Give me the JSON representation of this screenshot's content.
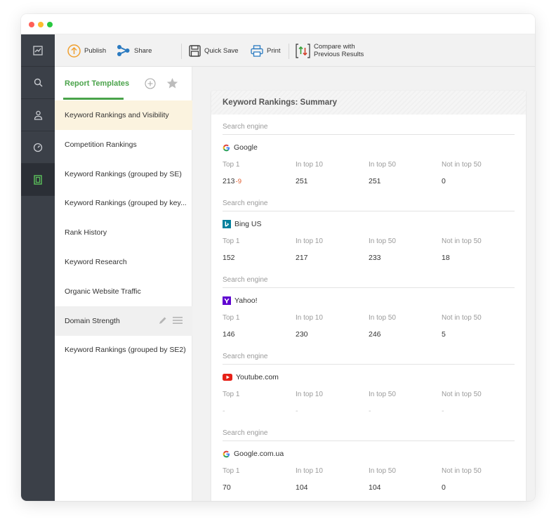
{
  "window": {
    "dots": [
      {
        "name": "close",
        "color": "#ff5f57"
      },
      {
        "name": "minimize",
        "color": "#febc2e"
      },
      {
        "name": "maximize",
        "color": "#28c840"
      }
    ]
  },
  "leftbar": {
    "items": [
      {
        "icon": "chart-icon",
        "active": false
      },
      {
        "icon": "search-icon",
        "active": false
      },
      {
        "icon": "user-icon",
        "active": false
      },
      {
        "icon": "gauge-icon",
        "active": false
      },
      {
        "icon": "report-icon",
        "active": true
      }
    ]
  },
  "toolbar": {
    "publish_label": "Publish",
    "share_label": "Share",
    "quick_save_label": "Quick Save",
    "print_label": "Print",
    "compare_label_line1": "Compare with",
    "compare_label_line2": "Previous Results"
  },
  "templates": {
    "tab_label": "Report Templates",
    "items": [
      "Keyword Rankings and Visibility",
      "Competition Rankings",
      "Keyword Rankings (grouped by SE)",
      "Keyword Rankings (grouped by key...",
      "Rank History",
      "Keyword Research",
      "Organic Website Traffic",
      "Domain Strength",
      "Keyword Rankings (grouped by SE2)"
    ],
    "selected_index": 0,
    "hover_index": 7
  },
  "report": {
    "title": "Keyword Rankings: Summary",
    "metric_headers": [
      "Top 1",
      "In top 10",
      "In top 50",
      "Not in top 50"
    ],
    "engines": [
      {
        "label": "Search engine",
        "name": "Google",
        "icon": "google-icon",
        "values": [
          "213",
          "251",
          "251",
          "0"
        ],
        "delta": "-9"
      },
      {
        "label": "Search engine",
        "name": "Bing US",
        "icon": "bing-icon",
        "values": [
          "152",
          "217",
          "233",
          "18"
        ],
        "delta": ""
      },
      {
        "label": "Search engine",
        "name": "Yahoo!",
        "icon": "yahoo-icon",
        "values": [
          "146",
          "230",
          "246",
          "5"
        ],
        "delta": ""
      },
      {
        "label": "Search engine",
        "name": "Youtube.com",
        "icon": "youtube-icon",
        "values": [
          "-",
          "-",
          "-",
          "-"
        ],
        "delta": ""
      },
      {
        "label": "Search engine",
        "name": "Google.com.ua",
        "icon": "google-icon",
        "values": [
          "70",
          "104",
          "104",
          "0"
        ],
        "delta": ""
      }
    ]
  },
  "colors": {
    "accent_green": "#4aa34a",
    "sidebar_bg": "#3b4048",
    "selected_bg": "#fbf3df",
    "delta_orange": "#e05a2b",
    "publish_orange": "#f0a030",
    "share_blue": "#2a7ac0",
    "compare_green": "#3aa03a",
    "compare_red": "#d0402a"
  }
}
